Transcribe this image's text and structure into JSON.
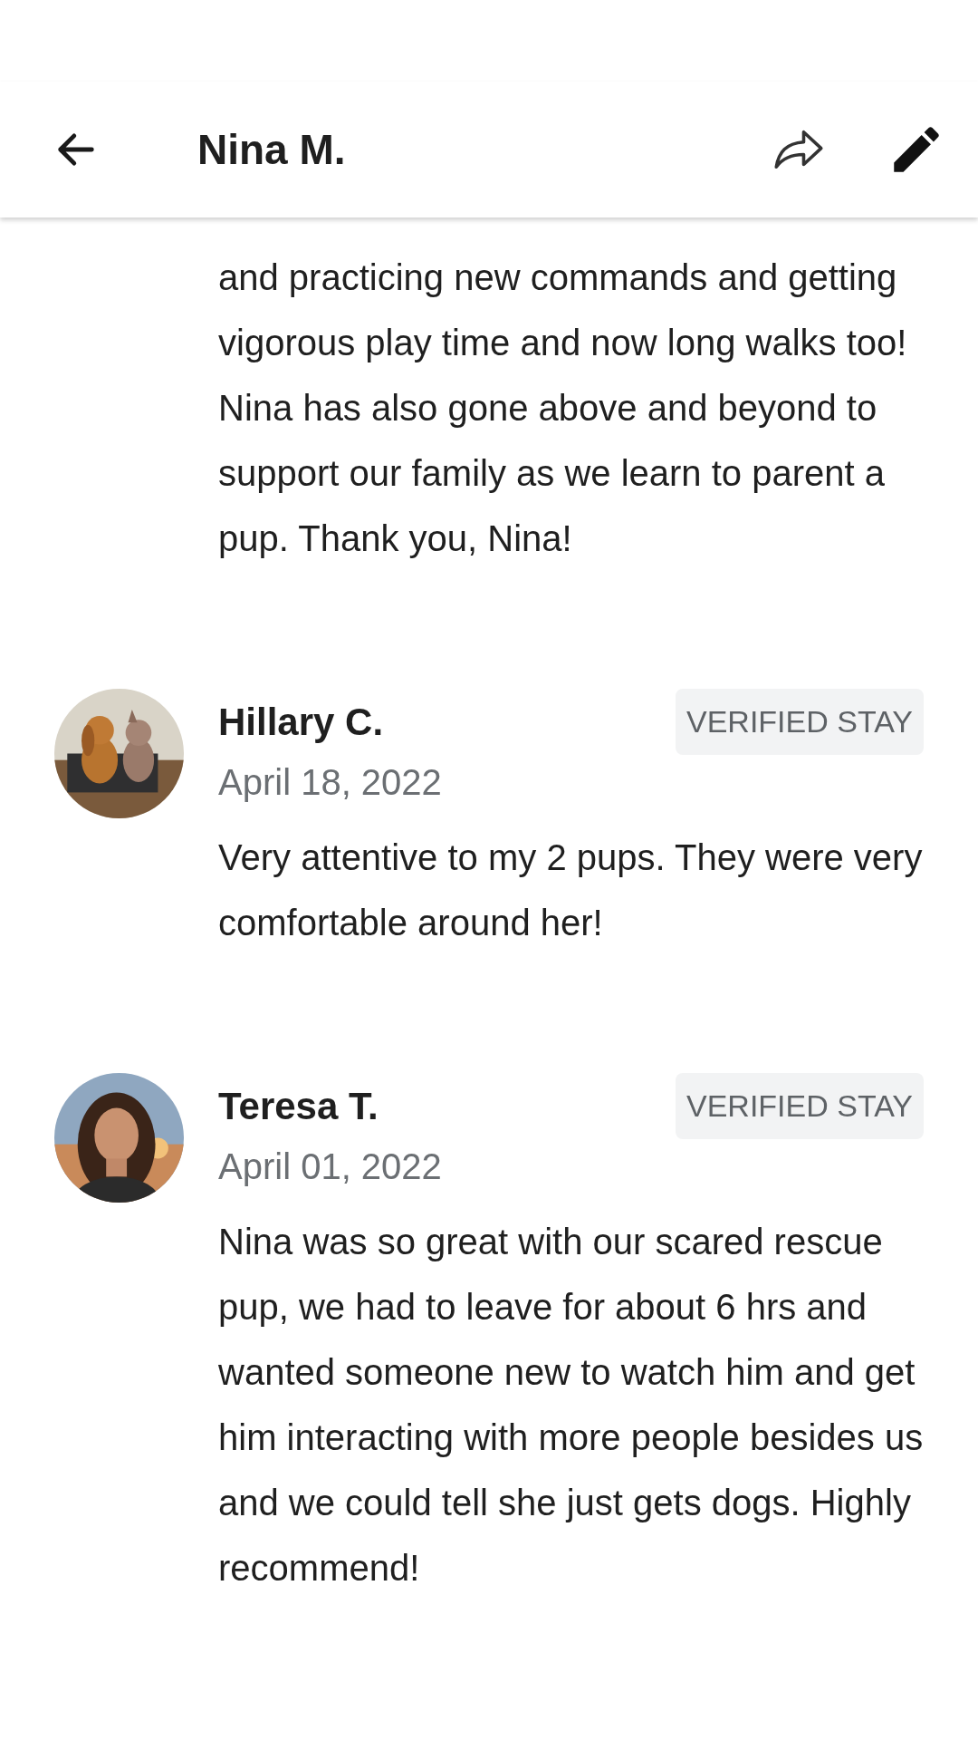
{
  "header": {
    "title": "Nina M."
  },
  "continued_review": {
    "text": "and practicing new commands and getting vigorous play time and now long walks too!  Nina has also gone above and beyond to support our family as we learn to parent a pup. Thank you, Nina!"
  },
  "reviews": [
    {
      "name": "Hillary C.",
      "date": "April 18, 2022",
      "badge": "VERIFIED STAY",
      "text": "Very attentive to my 2 pups. They were very comfortable around her!"
    },
    {
      "name": "Teresa T.",
      "date": "April 01, 2022",
      "badge": "VERIFIED STAY",
      "text": "Nina was so great with our scared rescue pup, we had to leave for about 6 hrs and wanted someone new to watch him and get him interacting with more people besides us and we could tell she just gets dogs. Highly recommend!"
    }
  ]
}
